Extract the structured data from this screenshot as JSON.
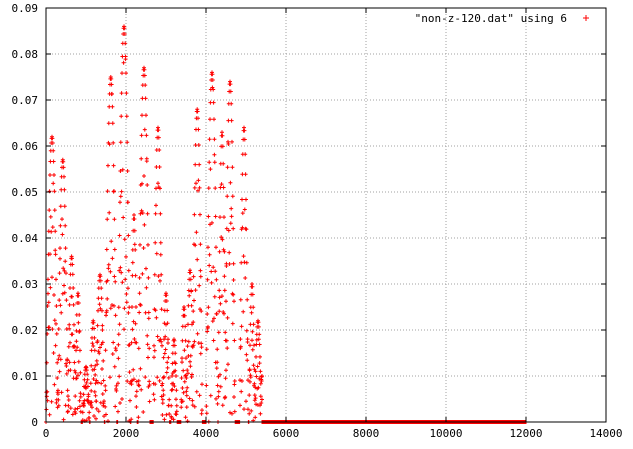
{
  "chart_data": {
    "type": "scatter",
    "title": "",
    "xlabel": "",
    "ylabel": "",
    "xlim": [
      0,
      14000
    ],
    "ylim": [
      0,
      0.09
    ],
    "x_ticks": [
      "0",
      "2000",
      "4000",
      "6000",
      "8000",
      "10000",
      "12000",
      "14000"
    ],
    "y_ticks": [
      "0",
      "0.01",
      "0.02",
      "0.03",
      "0.04",
      "0.05",
      "0.06",
      "0.07",
      "0.08",
      "0.09"
    ],
    "grid": true,
    "legend_position": "top-right",
    "marker": "+",
    "colors": {
      "series": "#ff0000",
      "frame": "#000000",
      "grid": "#a0a0a0"
    },
    "series": [
      {
        "name": "\"non-z-120.dat\" using 6",
        "envelope": [
          {
            "center": 150,
            "peak": 0.062,
            "half_width": 150
          },
          {
            "center": 420,
            "peak": 0.057,
            "half_width": 130
          },
          {
            "center": 640,
            "peak": 0.036,
            "half_width": 100
          },
          {
            "center": 800,
            "peak": 0.028,
            "half_width": 80
          },
          {
            "center": 1000,
            "peak": 0.012,
            "half_width": 90
          },
          {
            "center": 1180,
            "peak": 0.022,
            "half_width": 80
          },
          {
            "center": 1350,
            "peak": 0.032,
            "half_width": 110
          },
          {
            "center": 1620,
            "peak": 0.075,
            "half_width": 150
          },
          {
            "center": 1950,
            "peak": 0.086,
            "half_width": 160
          },
          {
            "center": 2200,
            "peak": 0.045,
            "half_width": 80
          },
          {
            "center": 2450,
            "peak": 0.077,
            "half_width": 150
          },
          {
            "center": 2800,
            "peak": 0.064,
            "half_width": 120
          },
          {
            "center": 3000,
            "peak": 0.028,
            "half_width": 90
          },
          {
            "center": 3200,
            "peak": 0.018,
            "half_width": 80
          },
          {
            "center": 3450,
            "peak": 0.025,
            "half_width": 80
          },
          {
            "center": 3600,
            "peak": 0.033,
            "half_width": 90
          },
          {
            "center": 3780,
            "peak": 0.068,
            "half_width": 130
          },
          {
            "center": 4150,
            "peak": 0.076,
            "half_width": 150
          },
          {
            "center": 4400,
            "peak": 0.063,
            "half_width": 100
          },
          {
            "center": 4600,
            "peak": 0.074,
            "half_width": 130
          },
          {
            "center": 4950,
            "peak": 0.064,
            "half_width": 110
          },
          {
            "center": 5150,
            "peak": 0.03,
            "half_width": 80
          },
          {
            "center": 5300,
            "peak": 0.022,
            "half_width": 90
          },
          {
            "center": 5400,
            "peak": 0.01,
            "half_width": 80
          }
        ],
        "baseline_range": [
          5400,
          12000
        ],
        "baseline_value": 0
      }
    ]
  }
}
